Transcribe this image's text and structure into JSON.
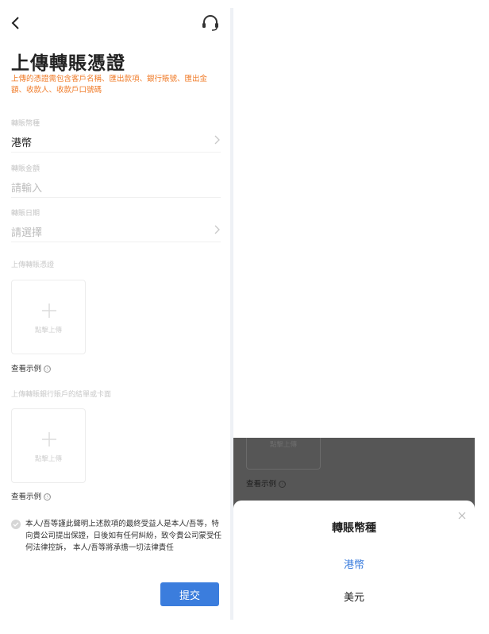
{
  "page": {
    "title": "上傳轉賬憑證",
    "description": "上傳的憑證需包含客戶名稱、匯出款項、銀行賬號、匯出金額、收款人、收款戶口號碼"
  },
  "form": {
    "currency": {
      "label": "轉賬幣種",
      "value": "港幣"
    },
    "amount": {
      "label": "轉賬金額",
      "placeholder": "請輸入"
    },
    "date": {
      "label": "轉賬日期",
      "placeholder": "請選擇"
    },
    "upload1": {
      "label": "上傳轉賬憑證",
      "button": "點擊上傳",
      "example": "查看示例",
      "info_icon": "ⓘ"
    },
    "upload2": {
      "label": "上傳轉賬銀行賬戶的結單或卡面",
      "button": "點擊上傳",
      "example": "查看示例",
      "info_icon": "ⓘ"
    },
    "declaration": "本人/吾等謹此聲明上述款項的最終受益人是本人/吾等，特向貴公司提出保證，日後如有任何糾紛，致令貴公司蒙受任何法律控訴， 本人/吾等將承擔一切法律責任",
    "submit": "提交"
  },
  "overlay": {
    "ghost_upload": "點擊上傳",
    "ghost_example": "查看示例",
    "ghost_info_icon": "ⓘ"
  },
  "sheet": {
    "title": "轉賬幣種",
    "options": [
      {
        "label": "港幣",
        "selected": true
      },
      {
        "label": "美元",
        "selected": false
      }
    ]
  },
  "colors": {
    "accent": "#3b7ddd",
    "warning": "#f07c2a",
    "overlay": "#565656"
  },
  "icons": [
    "back-arrow-icon",
    "headset-icon",
    "chevron-right-icon",
    "plus-icon",
    "info-icon",
    "check-icon",
    "close-icon"
  ]
}
